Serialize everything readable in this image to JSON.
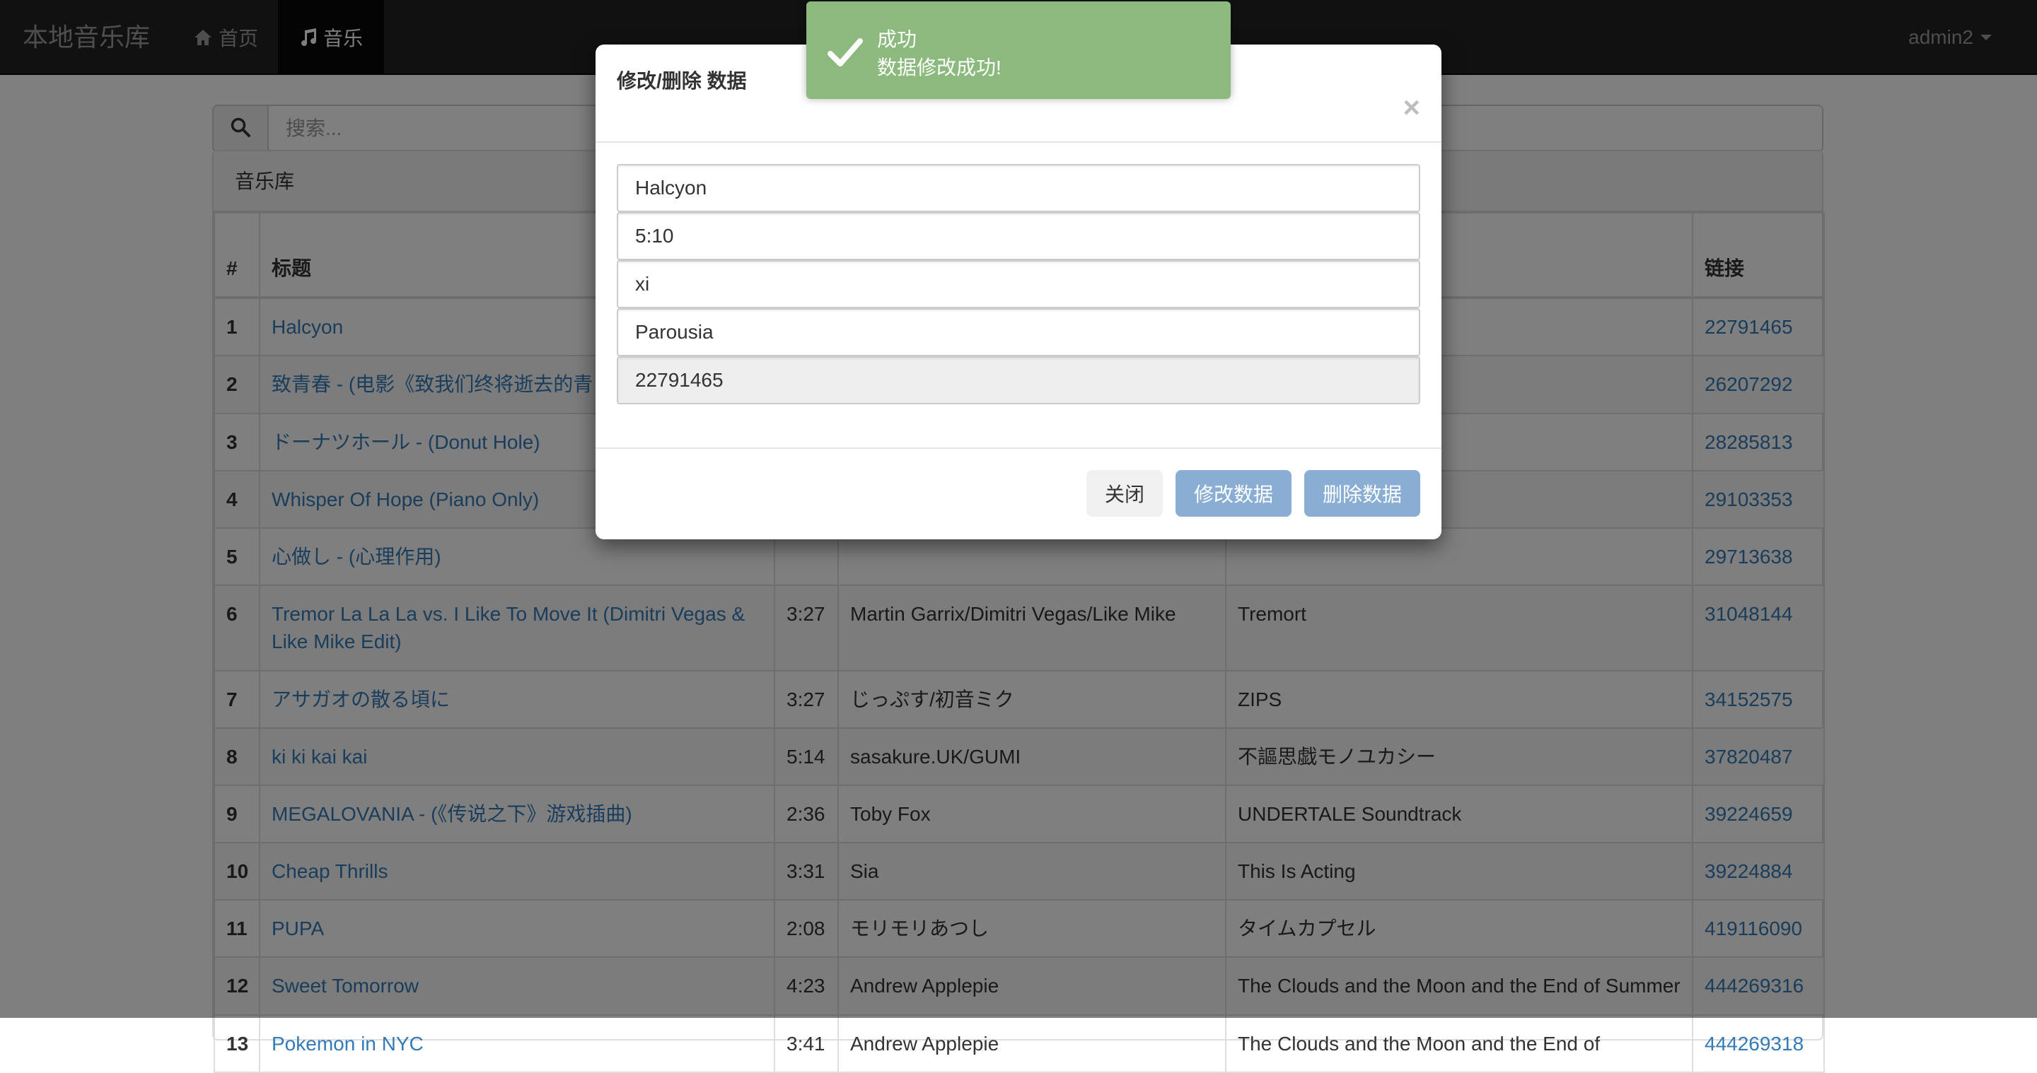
{
  "navbar": {
    "brand": "本地音乐库",
    "home_label": "首页",
    "music_label": "音乐",
    "user": "admin2"
  },
  "search": {
    "placeholder": "搜索..."
  },
  "panel": {
    "heading": "音乐库"
  },
  "table": {
    "headers": {
      "num": "#",
      "title": "标题",
      "duration": "",
      "artist": "",
      "album": "",
      "link": "链接"
    },
    "rows": [
      {
        "num": "1",
        "title": "Halcyon",
        "duration": "",
        "artist": "",
        "album": "",
        "link": "22791465"
      },
      {
        "num": "2",
        "title": "致青春 - (电影《致我们终将逝去的青",
        "duration": "",
        "artist": "",
        "album": "",
        "link": "26207292"
      },
      {
        "num": "3",
        "title": "ドーナツホール - (Donut Hole)",
        "duration": "",
        "artist": "",
        "album": "",
        "link": "28285813"
      },
      {
        "num": "4",
        "title": "Whisper Of Hope (Piano Only)",
        "duration": "",
        "artist": "",
        "album": "",
        "link": "29103353"
      },
      {
        "num": "5",
        "title": "心做し - (心理作用)",
        "duration": "",
        "artist": "",
        "album": "",
        "link": "29713638"
      },
      {
        "num": "6",
        "title": "Tremor La La La vs. I Like To Move It (Dimitri Vegas & Like Mike Edit)",
        "duration": "3:27",
        "artist": "Martin Garrix/Dimitri Vegas/Like Mike",
        "album": "Tremort",
        "link": "31048144"
      },
      {
        "num": "7",
        "title": "アサガオの散る頃に",
        "duration": "3:27",
        "artist": "じっぷす/初音ミク",
        "album": "ZIPS",
        "link": "34152575"
      },
      {
        "num": "8",
        "title": "ki ki kai kai",
        "duration": "5:14",
        "artist": "sasakure.UK/GUMI",
        "album": "不謳思戯モノユカシー",
        "link": "37820487"
      },
      {
        "num": "9",
        "title": "MEGALOVANIA - (《传说之下》游戏插曲)",
        "duration": "2:36",
        "artist": "Toby Fox",
        "album": "UNDERTALE Soundtrack",
        "link": "39224659"
      },
      {
        "num": "10",
        "title": "Cheap Thrills",
        "duration": "3:31",
        "artist": "Sia",
        "album": "This Is Acting",
        "link": "39224884"
      },
      {
        "num": "11",
        "title": "PUPA",
        "duration": "2:08",
        "artist": "モリモリあつし",
        "album": "タイムカプセル",
        "link": "419116090"
      },
      {
        "num": "12",
        "title": "Sweet Tomorrow",
        "duration": "4:23",
        "artist": "Andrew Applepie",
        "album": "The Clouds and the Moon and the End of Summer",
        "link": "444269316"
      },
      {
        "num": "13",
        "title": "Pokemon in NYC",
        "duration": "3:41",
        "artist": "Andrew Applepie",
        "album": "The Clouds and the Moon and the End of",
        "link": "444269318"
      }
    ]
  },
  "modal": {
    "title": "修改/删除 数据",
    "close_symbol": "×",
    "fields": {
      "title": "Halcyon",
      "duration": "5:10",
      "artist": "xi",
      "album": "Parousia",
      "id": "22791465"
    },
    "buttons": {
      "close": "关闭",
      "edit": "修改数据",
      "delete": "删除数据"
    }
  },
  "toast": {
    "title": "成功",
    "message": "数据修改成功!",
    "color": "#8cb97d"
  },
  "icons": {
    "home": "home-icon",
    "music": "music-note-icon",
    "search": "search-icon",
    "check": "check-icon",
    "caret": "caret-down-icon"
  }
}
